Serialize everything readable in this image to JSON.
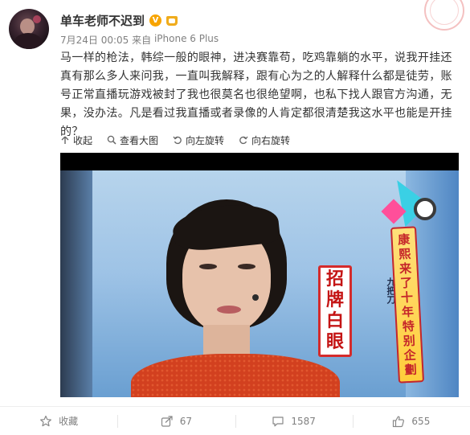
{
  "author": {
    "name": "单车老师不迟到",
    "verified_badge": "V",
    "avatar_icon": "avatar"
  },
  "meta": {
    "time": "7月24日 00:05",
    "source_prefix": " 来自 ",
    "source": "iPhone 6 Plus"
  },
  "content": {
    "text": "马一样的枪法，韩综一般的眼神，进决赛靠苟，吃鸡靠躺的水平，说我开挂还真有那么多人来问我，一直叫我解释，跟有心为之的人解释什么都是徒劳，账号正常直播玩游戏被封了我也很莫名也很绝望啊，也私下找人跟官方沟通，无果，没办法。凡是看过我直播或者录像的人肯定都很清楚我这水平也能是开挂的？"
  },
  "image_actions": [
    {
      "label": "收起",
      "icon": "collapse-arrow-icon"
    },
    {
      "label": "查看大图",
      "icon": "zoom-icon"
    },
    {
      "label": "向左旋转",
      "icon": "rotate-left-icon"
    },
    {
      "label": "向右旋转",
      "icon": "rotate-right-icon"
    }
  ],
  "media": {
    "sign_chars": [
      "招",
      "牌",
      "白",
      "眼"
    ],
    "banner_chars": [
      "康",
      "熙",
      "来",
      "了",
      "十",
      "年",
      "特",
      "别",
      "企",
      "劃"
    ],
    "side_caption": "九把刀"
  },
  "footer": [
    {
      "label": "收藏",
      "icon": "star-icon"
    },
    {
      "label": "67",
      "icon": "share-icon"
    },
    {
      "label": "1587",
      "icon": "comment-icon"
    },
    {
      "label": "655",
      "icon": "thumbs-up-icon"
    }
  ],
  "colors": {
    "text": "#333333",
    "muted": "#808080",
    "verified": "#f7a400",
    "sign_red": "#c41414"
  }
}
